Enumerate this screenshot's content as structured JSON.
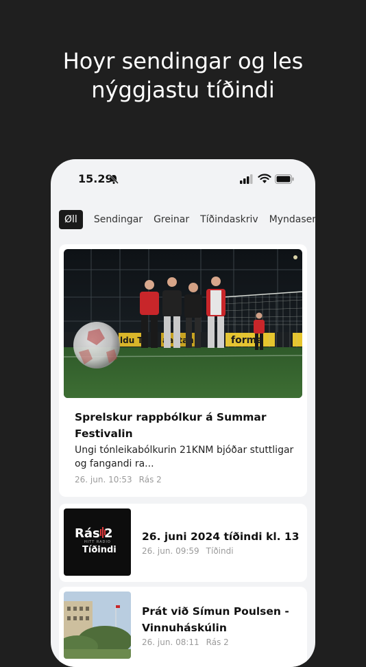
{
  "promo": {
    "line1": "Hoyr sendingar og les",
    "line2": "nýggjastu tíðindi"
  },
  "status_bar": {
    "time": "15.29"
  },
  "tabs": [
    {
      "label": "Øll",
      "active": true
    },
    {
      "label": "Sendingar",
      "active": false
    },
    {
      "label": "Greinar",
      "active": false
    },
    {
      "label": "Tíðindaskriv",
      "active": false
    },
    {
      "label": "Myndasendingar",
      "active": false
    }
  ],
  "featured": {
    "title": "Sprelskur rappbólkur á Summar Festivalin",
    "excerpt": "Ungi tónleikabólkurin 21KNM bjóðar stuttligar og fangandi ra...",
    "date": "26. jun. 10:53",
    "source": "Rás 2",
    "banner_text_1": "ldu Ta",
    "banner_text_2": "aastan",
    "banner_text_3": "forma"
  },
  "items": [
    {
      "title": "26. juni 2024 tíðindi kl. 13",
      "date": "26. jun. 09:59",
      "source": "Tíðindi",
      "logo": {
        "brand": "Rás 2",
        "sub": "HITT RADIO",
        "label": "Tíðindi"
      }
    },
    {
      "title": "Prát við Símun Poulsen - Vinnuháskúlin",
      "date": "26. jun. 08:11",
      "source": "Rás 2"
    }
  ],
  "colors": {
    "background": "#1f1f1f",
    "phone_bg": "#f2f3f5",
    "active_tab": "#1a1a1a",
    "logo_red": "#e0383a"
  }
}
